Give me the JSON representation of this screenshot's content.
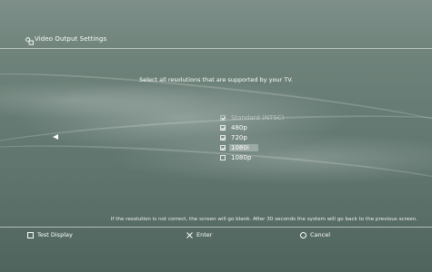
{
  "header": {
    "title": "Video Output Settings",
    "icon": "display-settings-icon"
  },
  "instruction": "Select all resolutions that are supported by your TV.",
  "resolutions": [
    {
      "label": "Standard (NTSC)",
      "checked": true,
      "state": "disabled"
    },
    {
      "label": "480p",
      "checked": true,
      "state": "normal"
    },
    {
      "label": "720p",
      "checked": true,
      "state": "normal"
    },
    {
      "label": "1080i",
      "checked": true,
      "state": "selected"
    },
    {
      "label": "1080p",
      "checked": false,
      "state": "normal"
    }
  ],
  "note": "If the resolution is not correct, the screen will go blank. After 30 seconds the system will go back to the previous screen.",
  "footer": {
    "test_display": "Test Display",
    "enter": "Enter",
    "cancel": "Cancel",
    "square_icon": "square-button-icon",
    "cross_icon": "cross-button-icon",
    "circle_icon": "circle-button-icon"
  }
}
